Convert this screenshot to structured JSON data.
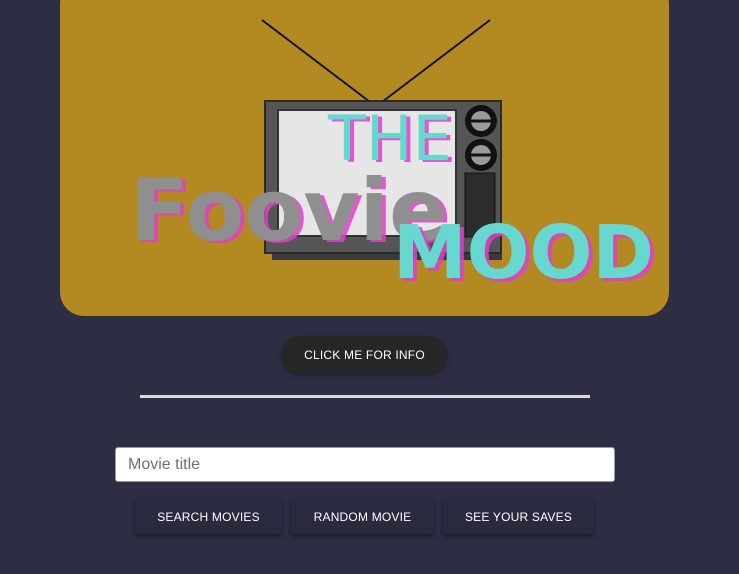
{
  "banner": {
    "logo_line1": "THE",
    "logo_line2a": "Foovie",
    "logo_line2b": "MOOD",
    "background_color": "#b28a21"
  },
  "info_button": {
    "label": "CLICK ME FOR INFO"
  },
  "search": {
    "placeholder": "Movie title",
    "value": ""
  },
  "actions": {
    "search_label": "SEARCH MOVIES",
    "random_label": "RANDOM MOVIE",
    "saves_label": "SEE YOUR SAVES"
  }
}
